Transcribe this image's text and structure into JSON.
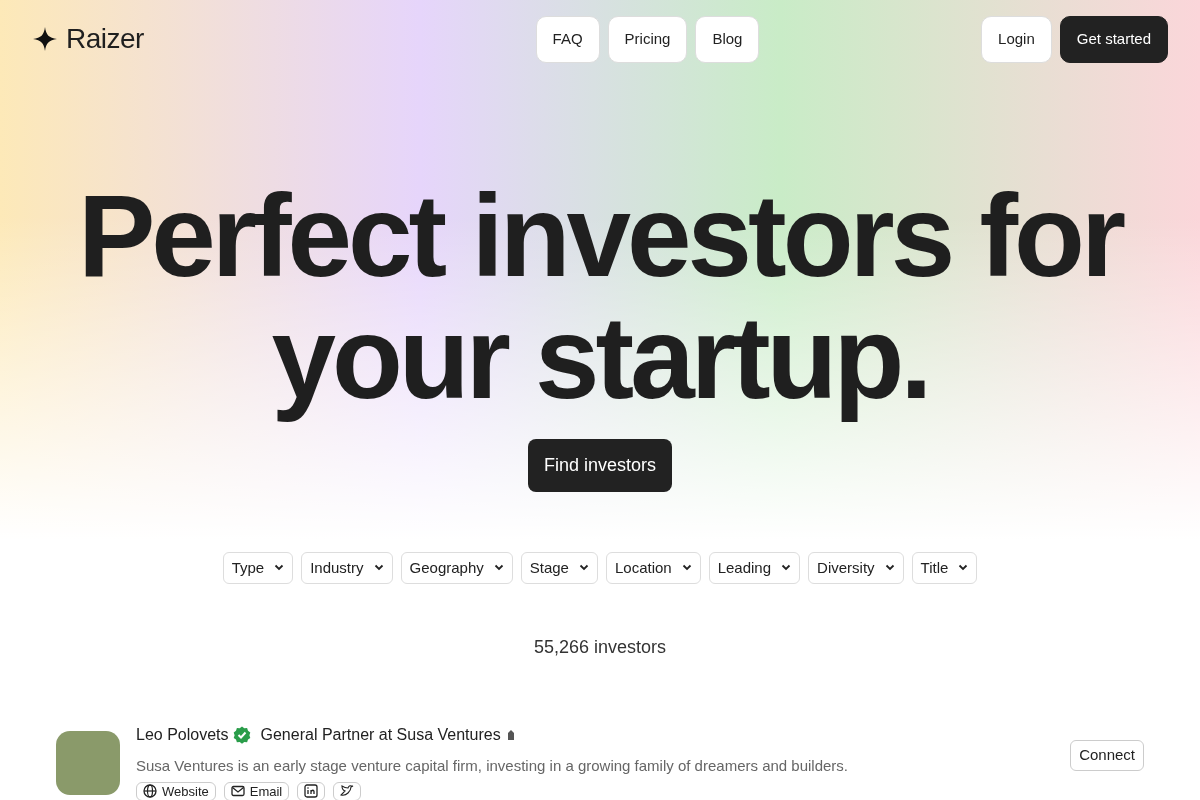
{
  "brand": {
    "name": "Raizer"
  },
  "nav_links": [
    "FAQ",
    "Pricing",
    "Blog"
  ],
  "nav_actions": [
    {
      "label": "Login",
      "kind": "outline"
    },
    {
      "label": "Get started",
      "kind": "dark"
    }
  ],
  "hero": {
    "title_lines": [
      "Perfect investors for",
      "your startup."
    ],
    "cta": "Find investors"
  },
  "filters": [
    "Type",
    "Industry",
    "Geography",
    "Stage",
    "Location",
    "Leading",
    "Diversity",
    "Title"
  ],
  "count": "55,266 investors",
  "investors": [
    {
      "name": "Leo Polovets",
      "verified": true,
      "title": "General Partner at Susa Ventures",
      "description": "Susa Ventures is an early stage venture capital firm, investing in a growing family of dreamers and builders.",
      "links": [
        {
          "kind": "website",
          "label": "Website"
        },
        {
          "kind": "email",
          "label": "Email"
        },
        {
          "kind": "linkedin"
        },
        {
          "kind": "twitter"
        }
      ],
      "action": "Connect"
    }
  ]
}
